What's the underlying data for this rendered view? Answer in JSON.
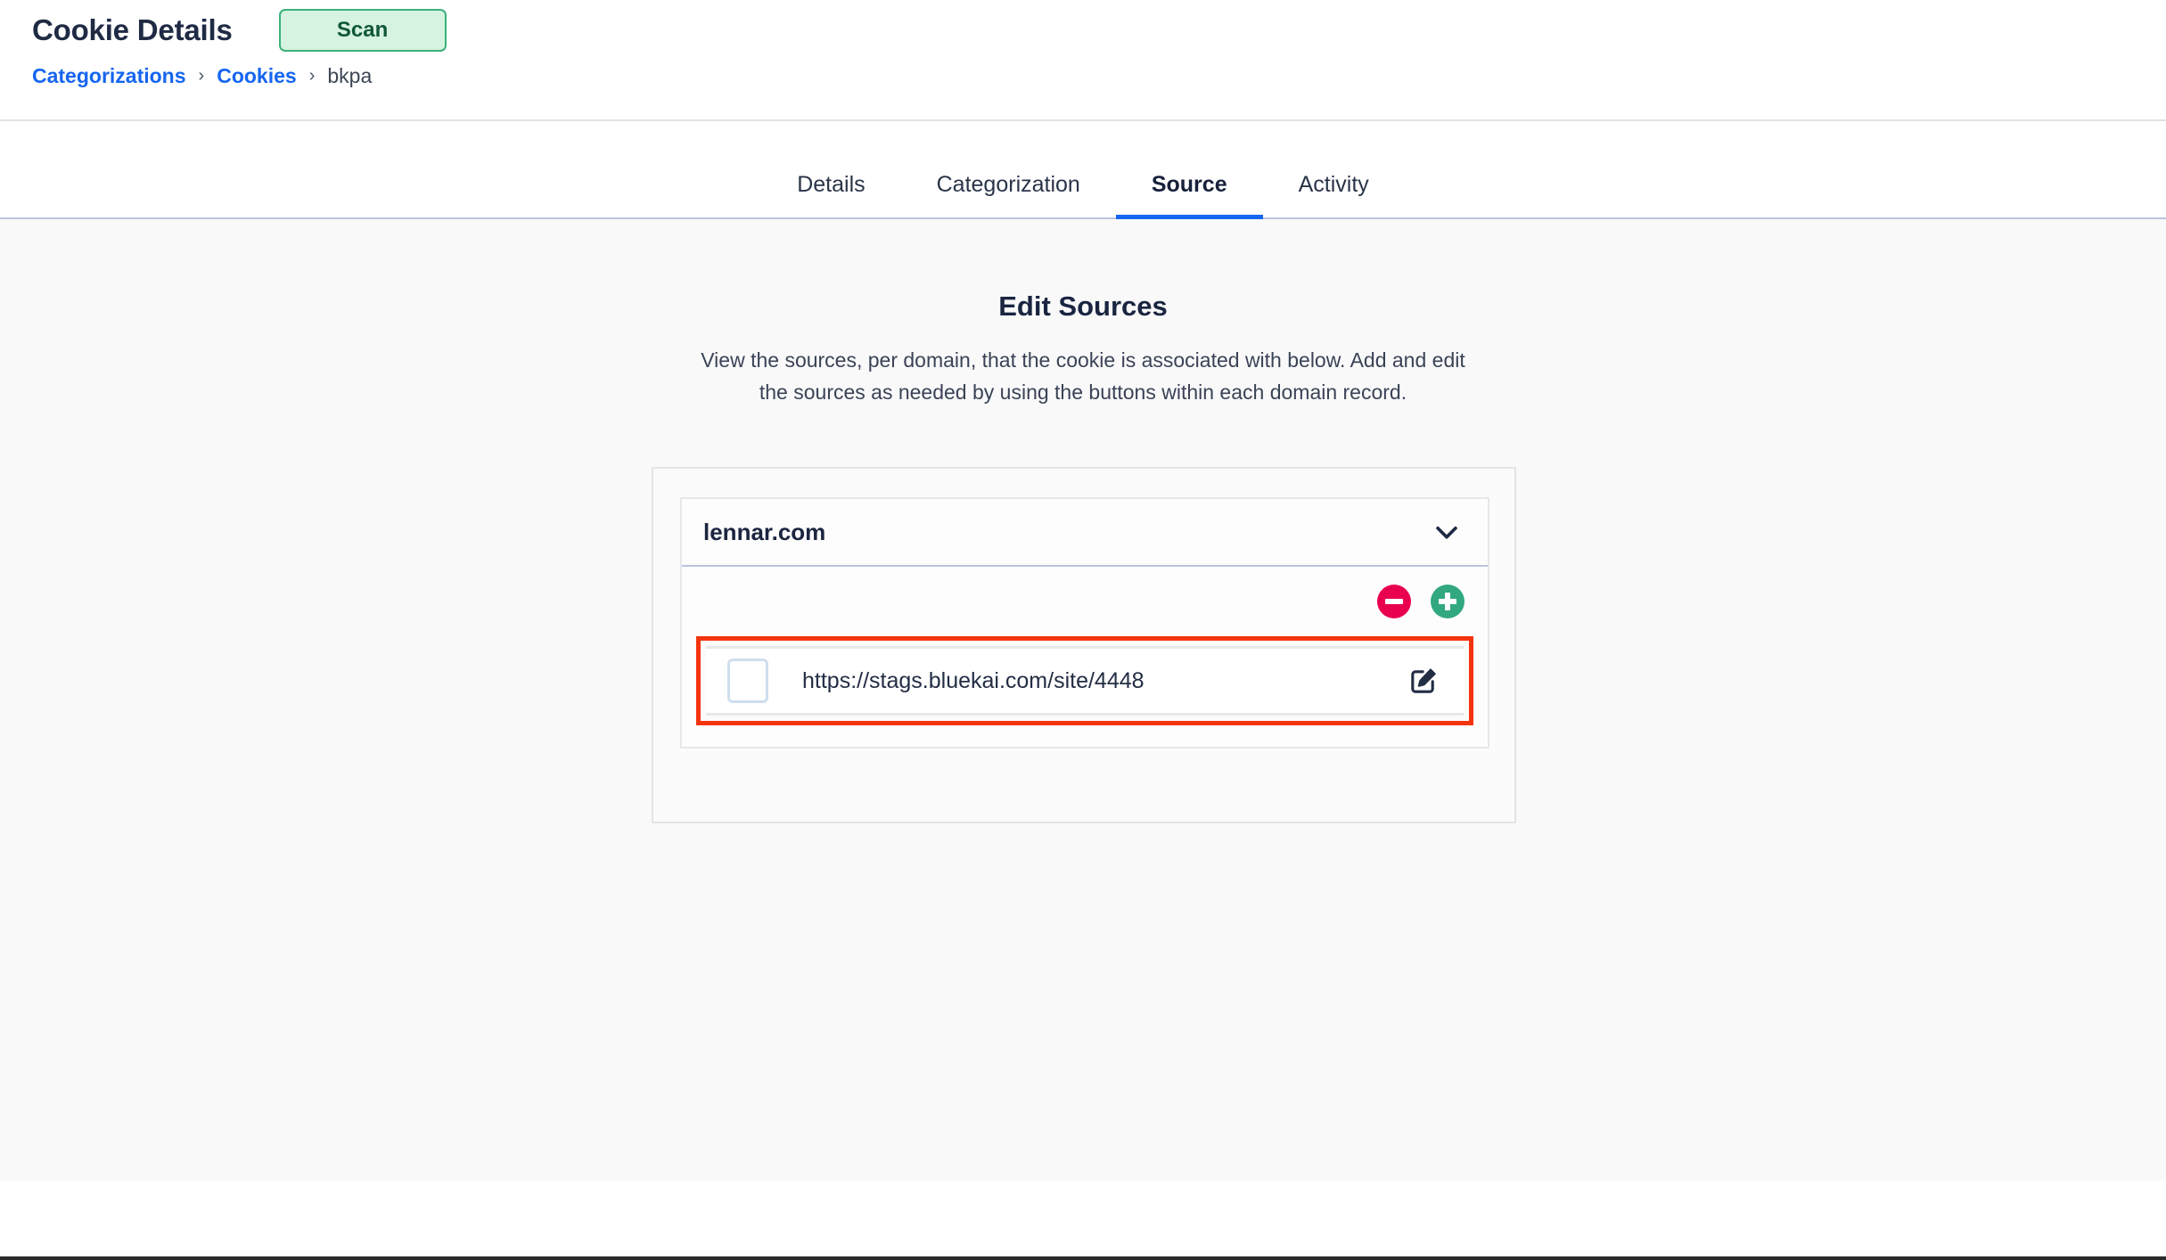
{
  "header": {
    "title": "Cookie Details",
    "scan_label": "Scan",
    "breadcrumb": {
      "items": [
        {
          "label": "Categorizations",
          "type": "link"
        },
        {
          "label": "Cookies",
          "type": "link"
        },
        {
          "label": "bkpa",
          "type": "current"
        }
      ],
      "separator": "›"
    }
  },
  "tabs": [
    {
      "label": "Details",
      "active": false
    },
    {
      "label": "Categorization",
      "active": false
    },
    {
      "label": "Source",
      "active": true
    },
    {
      "label": "Activity",
      "active": false
    }
  ],
  "main": {
    "title": "Edit Sources",
    "description": "View the sources, per domain, that the cookie is associated with below. Add and edit the sources as needed by using the buttons within each domain record.",
    "domain_card": {
      "domain": "lennar.com",
      "collapse_icon": "chevron-down-icon",
      "remove_button_icon": "minus-circle-icon",
      "add_button_icon": "plus-circle-icon",
      "sources": [
        {
          "url": "https://stags.bluekai.com/site/4448",
          "checked": false,
          "edit_icon": "edit-pencil-icon",
          "highlighted": true
        }
      ]
    }
  },
  "colors": {
    "link": "#1565f0",
    "tab_active_underline": "#1565f0",
    "scan_button_bg": "#d6f3e0",
    "scan_button_border": "#3bb179",
    "scan_button_text": "#11573a",
    "remove_button": "#e9004e",
    "add_button": "#31a87f",
    "highlight_outline": "#f4340e",
    "content_bg": "#f9f9fa",
    "text_primary": "#1f2a44"
  }
}
